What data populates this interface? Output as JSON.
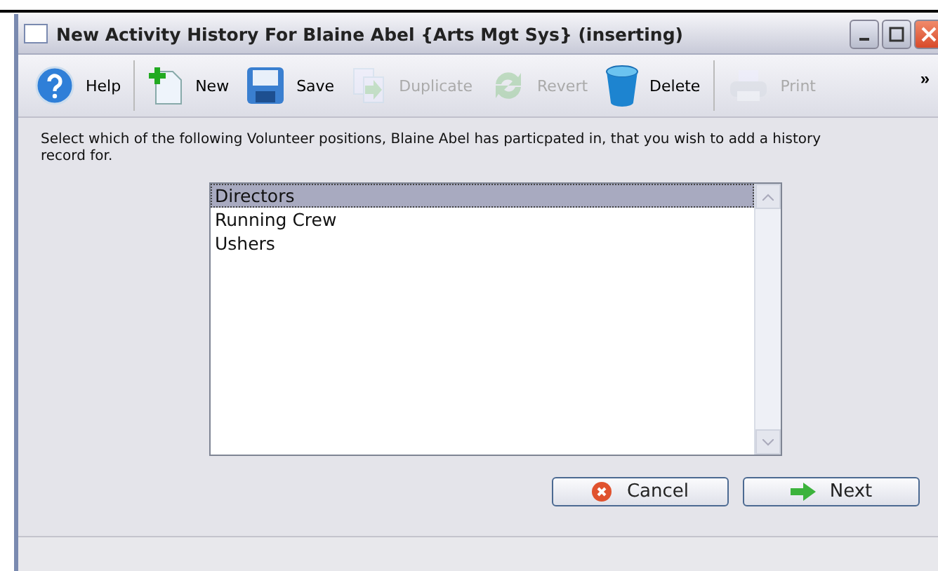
{
  "window": {
    "title": "New Activity History For Blaine Abel {Arts Mgt Sys} (inserting)"
  },
  "toolbar": [
    {
      "kind": "help",
      "label": "Help",
      "disabled": false
    },
    {
      "kind": "new",
      "label": "New",
      "disabled": false
    },
    {
      "kind": "save",
      "label": "Save",
      "disabled": false
    },
    {
      "kind": "duplicate",
      "label": "Duplicate",
      "disabled": true
    },
    {
      "kind": "revert",
      "label": "Revert",
      "disabled": true
    },
    {
      "kind": "delete",
      "label": "Delete",
      "disabled": false
    },
    {
      "kind": "print",
      "label": "Print",
      "disabled": true
    }
  ],
  "toolbar_more": "»",
  "instruction": "Select which of the following Volunteer positions, Blaine Abel has particpated in, that you wish to add a history record for.",
  "positions": [
    {
      "label": "Directors",
      "selected": true
    },
    {
      "label": "Running Crew",
      "selected": false
    },
    {
      "label": "Ushers",
      "selected": false
    }
  ],
  "buttons": [
    {
      "kind": "cancel",
      "label": "Cancel"
    },
    {
      "kind": "next",
      "label": "Next"
    }
  ]
}
